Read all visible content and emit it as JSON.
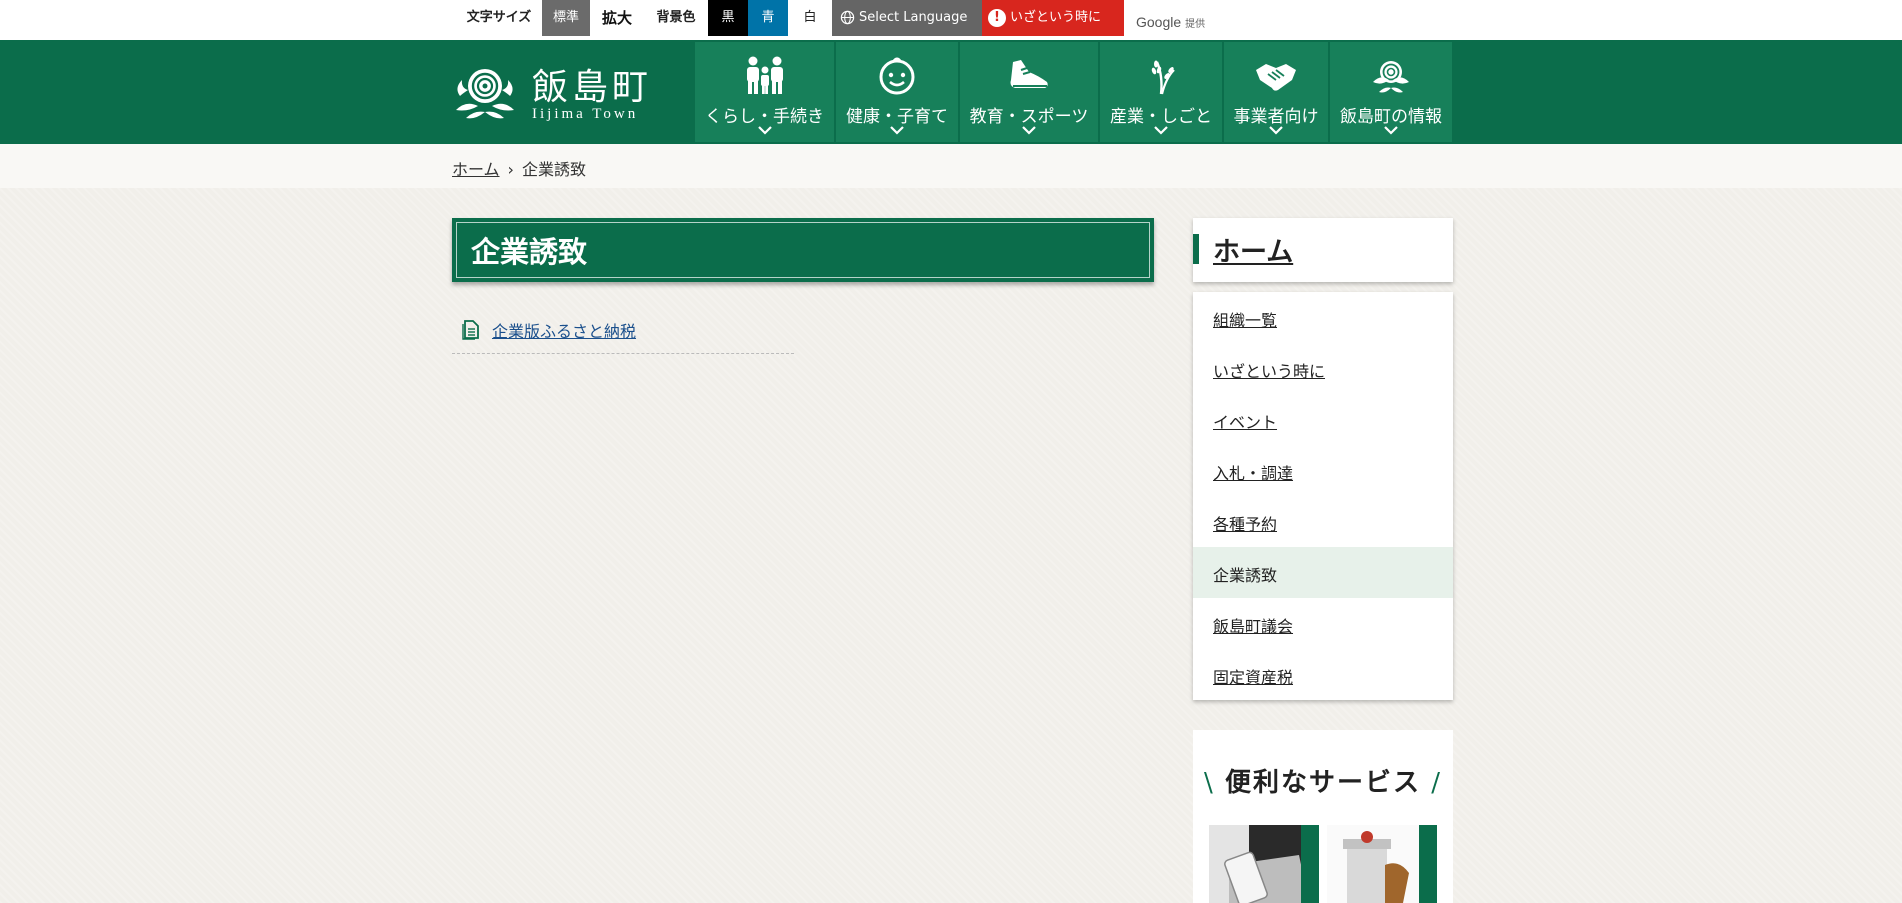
{
  "topbar": {
    "font_size_label": "文字サイズ",
    "font_standard": "標準",
    "font_large": "拡大",
    "bg_label": "背景色",
    "bg_black": "黒",
    "bg_blue": "青",
    "bg_white": "白",
    "select_language": "Select Language",
    "emergency": "いざという時に",
    "google": "Google",
    "google_provided": "提供"
  },
  "logo": {
    "name": "飯島町",
    "sub": "Iijima Town"
  },
  "nav": [
    {
      "label": "くらし・手続き",
      "icon": "family-icon"
    },
    {
      "label": "健康・子育て",
      "icon": "baby-face-icon"
    },
    {
      "label": "教育・スポーツ",
      "icon": "sneaker-icon"
    },
    {
      "label": "産業・しごと",
      "icon": "rice-plant-icon"
    },
    {
      "label": "事業者向け",
      "icon": "handshake-icon"
    },
    {
      "label": "飯島町の情報",
      "icon": "town-emblem-icon"
    }
  ],
  "breadcrumb": {
    "home": "ホーム",
    "current": "企業誘致"
  },
  "main": {
    "title": "企業誘致",
    "links": [
      {
        "label": "企業版ふるさと納税"
      }
    ]
  },
  "sidebar": {
    "home": "ホーム",
    "items": [
      {
        "label": "組織一覧"
      },
      {
        "label": "いざという時に"
      },
      {
        "label": "イベント"
      },
      {
        "label": "入札・調達"
      },
      {
        "label": "各種予約"
      },
      {
        "label": "企業誘致",
        "current": true
      },
      {
        "label": "飯島町議会"
      },
      {
        "label": "固定資産税"
      }
    ],
    "services_title": "便利なサービス"
  },
  "colors": {
    "brand_green": "#0b6d4b",
    "nav_green": "#17805a",
    "emergency_red": "#d8261e",
    "blue": "#0073a8"
  }
}
